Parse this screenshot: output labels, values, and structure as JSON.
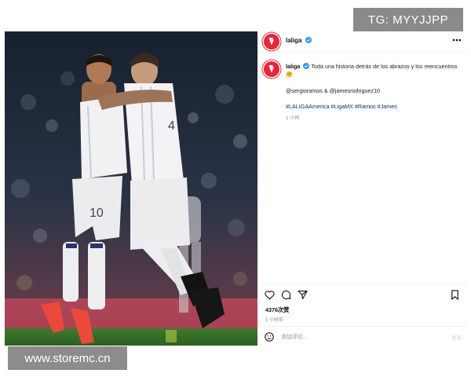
{
  "post": {
    "username": "laliga",
    "caption_text": "Toda una historia detrás de los abrazos y los reencuentros 🤗",
    "mentions": "@sergioramos & @jamesrodriguez10",
    "hashtags": "#LALIGAAmerica #LigaMX #Ramos #James",
    "caption_time": "1 小时",
    "likes": "4376次赞",
    "post_time": "1 小时前",
    "comment_placeholder": "添加评论...",
    "post_button": "发布"
  },
  "photo": {
    "left_jersey_number": "10",
    "right_jersey_number": "4"
  },
  "icons": [
    "laliga-logo-icon",
    "verified-icon",
    "more-options-icon",
    "heart-icon",
    "comment-icon",
    "share-icon",
    "bookmark-icon",
    "emoji-icon"
  ],
  "colors": {
    "brand": "#e8253a",
    "verified": "#3897f0",
    "hashtag": "#00376b",
    "muted": "#8e8e8e"
  },
  "watermarks": {
    "top_right": "TG: MYYJJPP",
    "bottom_left": "www.storemc.cn"
  }
}
